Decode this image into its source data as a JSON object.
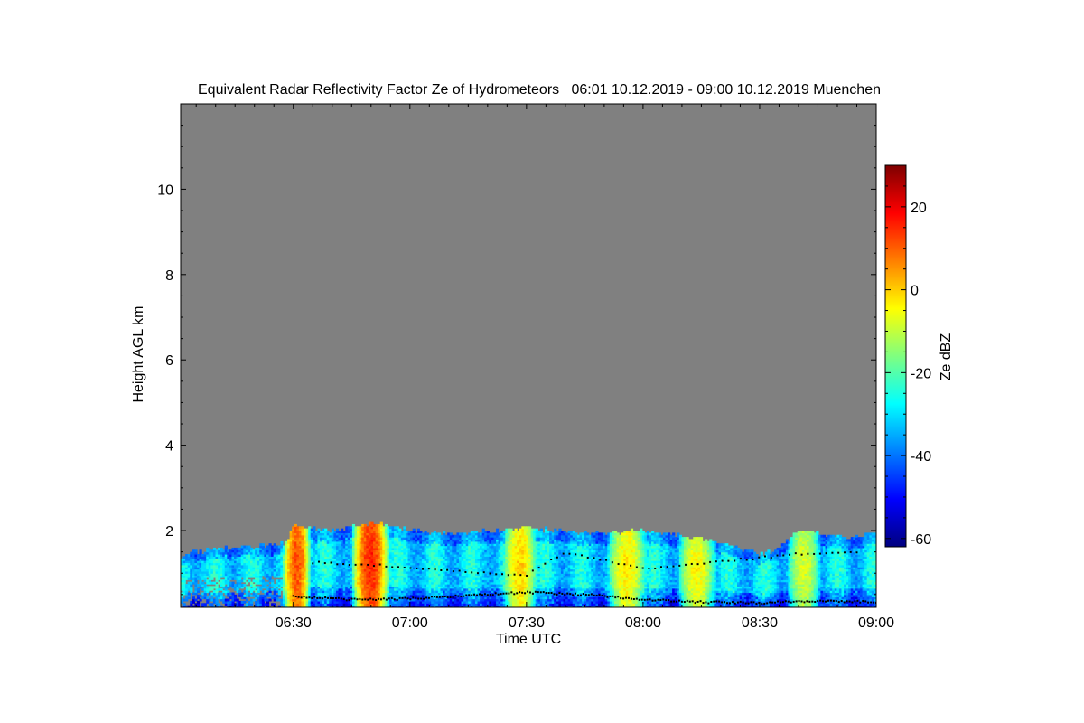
{
  "chart_data": {
    "type": "heatmap",
    "title": "Equivalent Radar Reflectivity Factor Ze of Hydrometeors   06:01 10.12.2019 - 09:00 10.12.2019 Muenchen",
    "xlabel": "Time UTC",
    "ylabel": "Height AGL km",
    "x_unit": "hours UTC",
    "xlim": [
      "06:01",
      "09:00"
    ],
    "ylim": [
      0.2,
      12
    ],
    "x_ticks": [
      "06:30",
      "07:00",
      "07:30",
      "08:00",
      "08:30",
      "09:00"
    ],
    "y_ticks": [
      2,
      4,
      6,
      8,
      10
    ],
    "background_color": "#808080",
    "colorbar": {
      "label": "Ze dBZ",
      "range": [
        -62,
        30
      ],
      "ticks": [
        -60,
        -40,
        -20,
        0,
        20
      ],
      "colormap": "jet"
    },
    "echo_top_km": [
      [
        "06:01",
        1.4
      ],
      [
        "06:10",
        1.55
      ],
      [
        "06:20",
        1.6
      ],
      [
        "06:28",
        1.7
      ],
      [
        "06:30",
        2.1
      ],
      [
        "06:40",
        1.95
      ],
      [
        "06:50",
        2.15
      ],
      [
        "07:00",
        2.0
      ],
      [
        "07:10",
        1.9
      ],
      [
        "07:20",
        1.95
      ],
      [
        "07:30",
        2.05
      ],
      [
        "07:40",
        1.95
      ],
      [
        "07:50",
        1.9
      ],
      [
        "08:00",
        2.0
      ],
      [
        "08:10",
        1.85
      ],
      [
        "08:20",
        1.7
      ],
      [
        "08:30",
        1.4
      ],
      [
        "08:35",
        1.55
      ],
      [
        "08:40",
        2.0
      ],
      [
        "08:50",
        1.8
      ],
      [
        "09:00",
        1.9
      ]
    ],
    "reflectivity_cells": [
      {
        "start": "06:28",
        "end": "06:34",
        "peak_dbz": 12
      },
      {
        "start": "06:46",
        "end": "06:54",
        "peak_dbz": 16
      },
      {
        "start": "07:25",
        "end": "07:32",
        "peak_dbz": 0
      },
      {
        "start": "07:52",
        "end": "08:00",
        "peak_dbz": -2
      },
      {
        "start": "08:10",
        "end": "08:18",
        "peak_dbz": -4
      },
      {
        "start": "08:38",
        "end": "08:45",
        "peak_dbz": -8
      }
    ],
    "cloud_base_km": [
      [
        "06:30",
        0.45
      ],
      [
        "06:45",
        0.38
      ],
      [
        "07:00",
        0.4
      ],
      [
        "07:15",
        0.48
      ],
      [
        "07:30",
        0.55
      ],
      [
        "07:45",
        0.5
      ],
      [
        "08:00",
        0.38
      ],
      [
        "08:15",
        0.32
      ],
      [
        "08:30",
        0.3
      ],
      [
        "08:45",
        0.35
      ],
      [
        "09:00",
        0.32
      ]
    ],
    "upper_layer_km": [
      [
        "06:35",
        1.25
      ],
      [
        "06:50",
        1.2
      ],
      [
        "07:10",
        1.05
      ],
      [
        "07:30",
        0.95
      ],
      [
        "07:40",
        1.5
      ],
      [
        "08:00",
        1.1
      ],
      [
        "08:40",
        1.45
      ],
      [
        "08:55",
        1.5
      ]
    ],
    "grid": false
  }
}
